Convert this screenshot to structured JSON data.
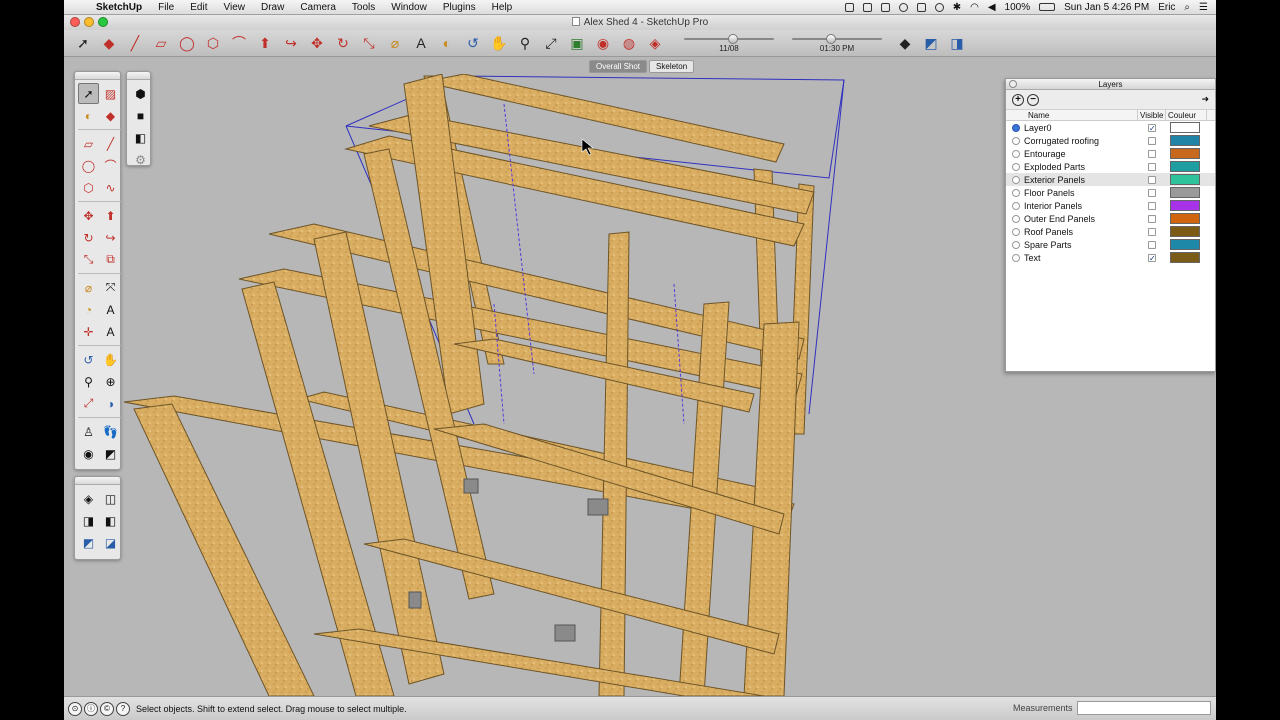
{
  "menubar": {
    "app": "SketchUp",
    "items": [
      "File",
      "Edit",
      "View",
      "Draw",
      "Camera",
      "Tools",
      "Window",
      "Plugins",
      "Help"
    ],
    "battery": "100%",
    "datetime": "Sun Jan 5  4:26 PM",
    "user": "Eric"
  },
  "window": {
    "title": "Alex Shed 4 - SketchUp Pro"
  },
  "toolbar": {
    "shadow_date": "11/08",
    "shadow_time": "01:30 PM",
    "shadow_date_level": 0.55,
    "shadow_time_level": 0.42
  },
  "scenes": [
    "Overall Shot",
    "Skeleton"
  ],
  "layers_panel": {
    "title": "Layers",
    "columns": {
      "name": "Name",
      "visible": "Visible",
      "color": "Couleur"
    },
    "rows": [
      {
        "name": "Layer0",
        "active": true,
        "visible": true,
        "color": "#ffffff"
      },
      {
        "name": "Corrugated roofing",
        "active": false,
        "visible": false,
        "color": "#1f84a6"
      },
      {
        "name": "Entourage",
        "active": false,
        "visible": false,
        "color": "#c8681c"
      },
      {
        "name": "Exploded Parts",
        "active": false,
        "visible": false,
        "color": "#1e9ea0"
      },
      {
        "name": "Exterior Panels",
        "active": false,
        "visible": false,
        "color": "#2ec39a",
        "selected": true
      },
      {
        "name": "Floor Panels",
        "active": false,
        "visible": false,
        "color": "#9a9a9a"
      },
      {
        "name": "Interior Panels",
        "active": false,
        "visible": false,
        "color": "#a733e8"
      },
      {
        "name": "Outer End Panels",
        "active": false,
        "visible": false,
        "color": "#d0640f"
      },
      {
        "name": "Roof Panels",
        "active": false,
        "visible": false,
        "color": "#7c5a16"
      },
      {
        "name": "Spare Parts",
        "active": false,
        "visible": false,
        "color": "#1e88a8"
      },
      {
        "name": "Text",
        "active": false,
        "visible": true,
        "color": "#7a5b17"
      }
    ]
  },
  "statusbar": {
    "message": "Select objects. Shift to extend select. Drag mouse to select multiple.",
    "measurements_label": "Measurements",
    "measurements_value": ""
  }
}
